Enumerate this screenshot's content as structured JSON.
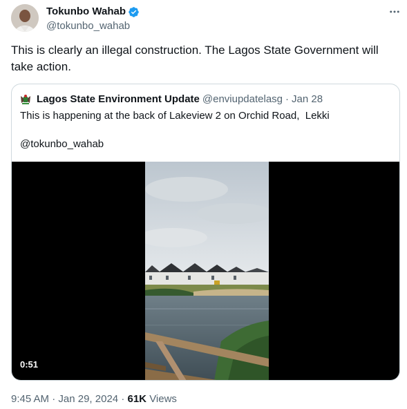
{
  "author": {
    "name": "Tokunbo Wahab",
    "handle": "@tokunbo_wahab",
    "verified_color": "#1d9bf0"
  },
  "tweet": {
    "text": "This is clearly an illegal construction. The Lagos State Government will take action."
  },
  "quoted": {
    "name": "Lagos State Environment Update",
    "handle": "@enviupdatelasg",
    "separator": "·",
    "date": "Jan 28",
    "text": "This is happening at the back of Lakeview 2 on Orchid Road,  Lekki",
    "mention": "@tokunbo_wahab",
    "video": {
      "duration": "0:51",
      "description_icon": "video-thumbnail"
    }
  },
  "footer": {
    "time": "9:45 AM",
    "separator1": "·",
    "date": "Jan 29, 2024",
    "separator2": "·",
    "views_count": "61K",
    "views_label": "Views"
  },
  "icons": {
    "more": "more-options-icon",
    "verified": "verified-badge-icon"
  }
}
